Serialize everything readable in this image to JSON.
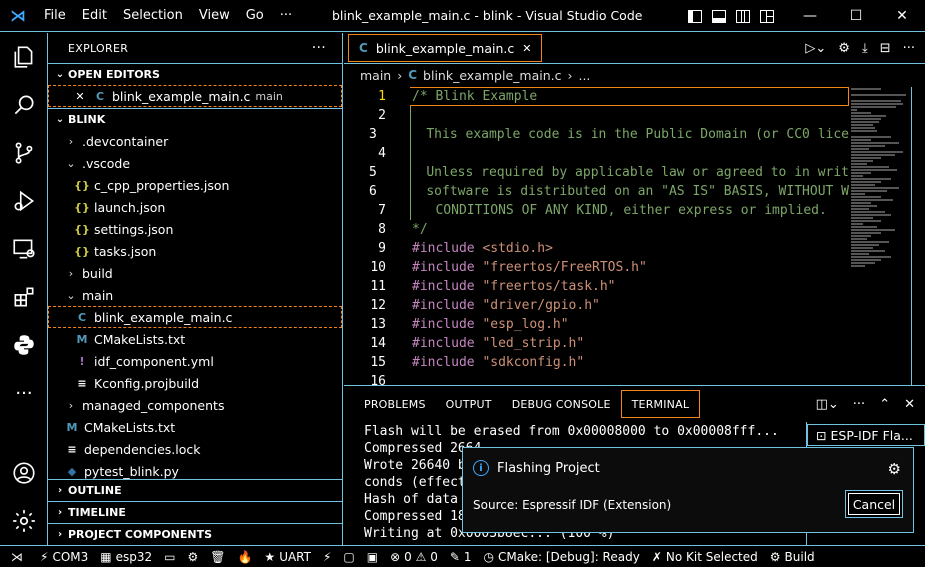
{
  "titlebar": {
    "menu": [
      "File",
      "Edit",
      "Selection",
      "View",
      "Go",
      "···"
    ],
    "window_title": "blink_example_main.c - blink - Visual Studio Code",
    "buttons": {
      "minimize": "—",
      "maximize": "☐",
      "close": "✕"
    }
  },
  "activitybar": {
    "items": [
      "explorer-icon",
      "search-icon",
      "source-control-icon",
      "run-debug-icon",
      "remote-explorer-icon",
      "extensions-icon",
      "python-icon",
      "more-icon"
    ],
    "bottom": [
      "account-icon",
      "settings-gear-icon"
    ]
  },
  "sidebar": {
    "title": "EXPLORER",
    "more": "···",
    "open_editors": {
      "label": "OPEN EDITORS",
      "items": [
        {
          "name": "blink_example_main.c",
          "hint": "main",
          "close": "✕",
          "icon": "C"
        }
      ]
    },
    "project": {
      "label": "BLINK",
      "tree": [
        {
          "name": ".devcontainer",
          "kind": "folder",
          "open": false,
          "chev": "›"
        },
        {
          "name": ".vscode",
          "kind": "folder",
          "open": true,
          "chev": "⌄"
        },
        {
          "name": "c_cpp_properties.json",
          "kind": "json",
          "icon": "{}"
        },
        {
          "name": "launch.json",
          "kind": "json",
          "icon": "{}"
        },
        {
          "name": "settings.json",
          "kind": "json",
          "icon": "{}"
        },
        {
          "name": "tasks.json",
          "kind": "json",
          "icon": "{}"
        },
        {
          "name": "build",
          "kind": "folder",
          "open": false,
          "chev": "›"
        },
        {
          "name": "main",
          "kind": "folder",
          "open": true,
          "chev": "⌄"
        },
        {
          "name": "blink_example_main.c",
          "kind": "c",
          "icon": "C",
          "selected": true
        },
        {
          "name": "CMakeLists.txt",
          "kind": "cmake",
          "icon": "M"
        },
        {
          "name": "idf_component.yml",
          "kind": "yml",
          "icon": "!"
        },
        {
          "name": "Kconfig.projbuild",
          "kind": "text",
          "icon": "≡"
        },
        {
          "name": "managed_components",
          "kind": "folder",
          "open": false,
          "chev": "›"
        },
        {
          "name": "CMakeLists.txt",
          "kind": "cmake",
          "icon": "M"
        },
        {
          "name": "dependencies.lock",
          "kind": "text",
          "icon": "≡"
        },
        {
          "name": "pytest_blink.py",
          "kind": "py",
          "icon": "◆"
        }
      ]
    },
    "collapsed_sections": [
      "OUTLINE",
      "TIMELINE",
      "PROJECT COMPONENTS"
    ]
  },
  "editor": {
    "tab": {
      "icon": "C",
      "label": "blink_example_main.c",
      "close": "✕"
    },
    "breadcrumb": {
      "folder": "main",
      "file": "blink_example_main.c",
      "more": "..."
    },
    "lines": [
      {
        "n": "1",
        "t": "/* Blink Example",
        "k": "com"
      },
      {
        "n": "2",
        "t": "",
        "k": "com"
      },
      {
        "n": "3",
        "t": "   This example code is in the Public Domain (or CC0 lice",
        "k": "com"
      },
      {
        "n": "4",
        "t": "",
        "k": "com"
      },
      {
        "n": "5",
        "t": "   Unless required by applicable law or agreed to in writ",
        "k": "com"
      },
      {
        "n": "6",
        "t": "   software is distributed on an \"AS IS\" BASIS, WITHOUT W",
        "k": "com"
      },
      {
        "n": "7",
        "t": "   CONDITIONS OF ANY KIND, either express or implied.",
        "k": "com"
      },
      {
        "n": "8",
        "t": "*/",
        "k": "com"
      },
      {
        "n": "9",
        "kw": "#include",
        "s": "<stdio.h>"
      },
      {
        "n": "10",
        "kw": "#include",
        "s": "\"freertos/FreeRTOS.h\""
      },
      {
        "n": "11",
        "kw": "#include",
        "s": "\"freertos/task.h\""
      },
      {
        "n": "12",
        "kw": "#include",
        "s": "\"driver/gpio.h\""
      },
      {
        "n": "13",
        "kw": "#include",
        "s": "\"esp_log.h\""
      },
      {
        "n": "14",
        "kw": "#include",
        "s": "\"led_strip.h\""
      },
      {
        "n": "15",
        "kw": "#include",
        "s": "\"sdkconfig.h\""
      },
      {
        "n": "16",
        "t": "",
        "k": "plain"
      }
    ]
  },
  "panel": {
    "tabs": [
      "PROBLEMS",
      "OUTPUT",
      "DEBUG CONSOLE",
      "TERMINAL"
    ],
    "active_tab": "TERMINAL",
    "terminal_lines": [
      "Flash will be erased from 0x00008000 to 0x00008fff...",
      "Compressed 2664",
      "Wrote 26640 by",
      "conds (effecti",
      "Hash of data v",
      "Compressed 182",
      "Writing at 0x0003b8ec... (100 %)"
    ],
    "terminal_list_item": "ESP-IDF Fla..."
  },
  "notification": {
    "title": "Flashing Project",
    "source": "Source: Espressif IDF (Extension)",
    "button": "Cancel"
  },
  "statusbar": {
    "items": [
      {
        "icon": "⚡",
        "label": "COM3"
      },
      {
        "icon": "▦",
        "label": "esp32"
      },
      {
        "icon": "▭",
        "label": ""
      },
      {
        "icon": "⚙",
        "label": ""
      },
      {
        "icon": "🗑",
        "label": ""
      },
      {
        "icon": "🔥",
        "label": ""
      },
      {
        "icon": "★",
        "label": "UART"
      },
      {
        "icon": "⚡",
        "label": ""
      },
      {
        "icon": "▢",
        "label": ""
      },
      {
        "icon": "▣",
        "label": ""
      },
      {
        "icon": "⊗",
        "label": "0 ⚠ 0"
      },
      {
        "icon": "✎",
        "label": "1"
      },
      {
        "icon": "◷",
        "label": "CMake: [Debug]: Ready"
      },
      {
        "icon": "✗",
        "label": "No Kit Selected"
      },
      {
        "icon": "⚙",
        "label": "Build"
      }
    ]
  }
}
